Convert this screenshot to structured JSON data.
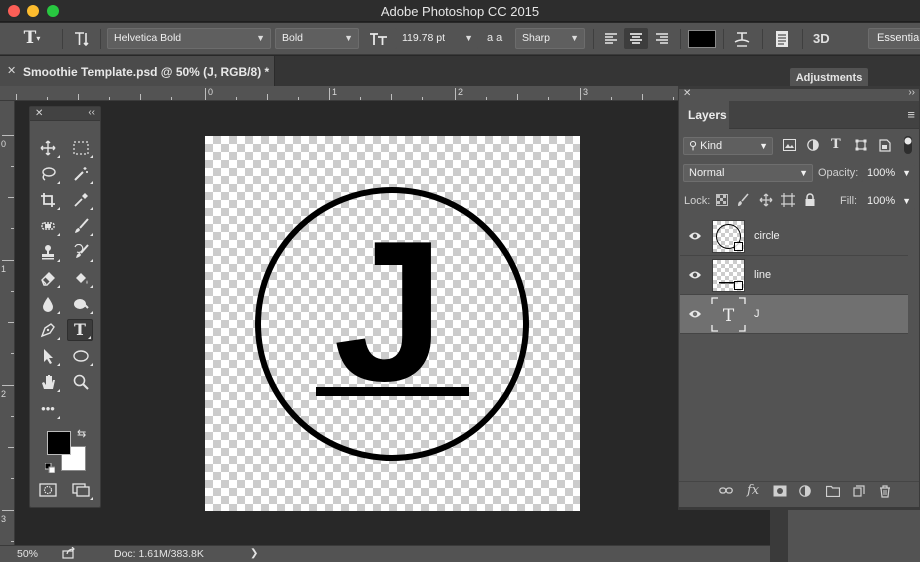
{
  "window": {
    "title": "Adobe Photoshop CC 2015"
  },
  "options_bar": {
    "font_family": "Helvetica Bold",
    "font_style": "Bold",
    "font_size": "119.78 pt",
    "aa_label": "a a",
    "antialias": "Sharp",
    "text_color": "#000000",
    "workspace": "Essential",
    "threed_label": "3D",
    "icons": [
      "type-tool-icon",
      "orientation-icon",
      "font-size-icon",
      "align-left-icon",
      "align-center-icon",
      "align-right-icon",
      "warp-text-icon",
      "character-panel-icon"
    ]
  },
  "document_tab": {
    "close": "✕",
    "title": "Smoothie Template.psd @ 50% (J, RGB/8) *"
  },
  "adjustments_tab": {
    "label": "Adjustments"
  },
  "ruler": {
    "h_marks": [
      "0",
      "1",
      "2",
      "3"
    ],
    "v_marks": [
      "0",
      "1",
      "2",
      "3"
    ]
  },
  "tools": [
    {
      "name": "move-tool-icon"
    },
    {
      "name": "marquee-tool-icon"
    },
    {
      "name": "lasso-tool-icon"
    },
    {
      "name": "magic-wand-tool-icon"
    },
    {
      "name": "crop-tool-icon"
    },
    {
      "name": "eyedropper-tool-icon"
    },
    {
      "name": "healing-brush-tool-icon"
    },
    {
      "name": "brush-tool-icon"
    },
    {
      "name": "clone-stamp-tool-icon"
    },
    {
      "name": "history-brush-tool-icon"
    },
    {
      "name": "eraser-tool-icon"
    },
    {
      "name": "paint-bucket-tool-icon"
    },
    {
      "name": "blur-tool-icon"
    },
    {
      "name": "dodge-tool-icon"
    },
    {
      "name": "pen-tool-icon"
    },
    {
      "name": "type-tool-icon",
      "active": true
    },
    {
      "name": "path-selection-tool-icon"
    },
    {
      "name": "ellipse-tool-icon"
    },
    {
      "name": "hand-tool-icon"
    },
    {
      "name": "zoom-tool-icon"
    },
    {
      "name": "more-tools-icon"
    }
  ],
  "colors": {
    "foreground": "#000000",
    "background": "#ffffff"
  },
  "canvas": {
    "letter": "J"
  },
  "layers_panel": {
    "tab": "Layers",
    "filter_kind": "Kind",
    "blend_mode": "Normal",
    "opacity_label": "Opacity:",
    "opacity": "100%",
    "lock_label": "Lock:",
    "fill_label": "Fill:",
    "fill": "100%",
    "layers": [
      {
        "name": "circle",
        "type": "smart",
        "selected": false
      },
      {
        "name": "line",
        "type": "smart",
        "selected": false
      },
      {
        "name": "J",
        "type": "text",
        "selected": true
      }
    ]
  },
  "status_bar": {
    "zoom": "50%",
    "doc_info": "Doc: 1.61M/383.8K",
    "arrow": "❯"
  }
}
